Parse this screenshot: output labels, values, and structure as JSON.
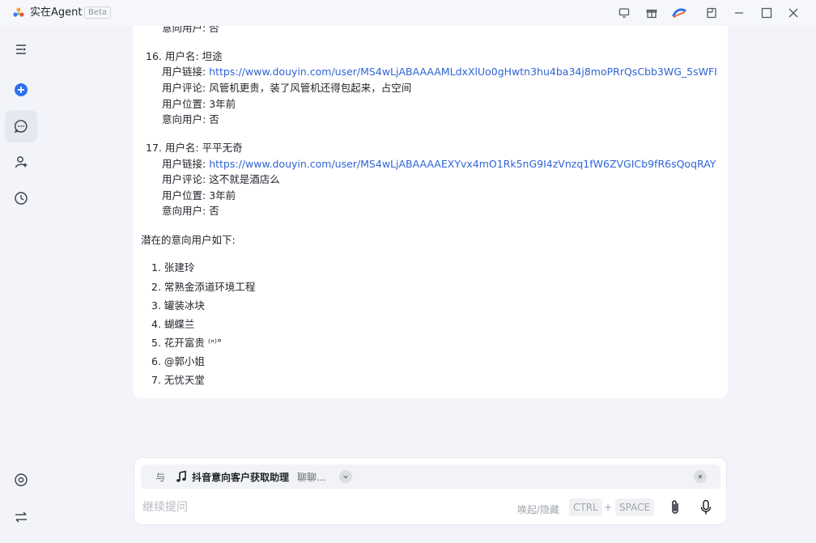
{
  "app": {
    "title": "实在Agent",
    "badge": "Beta"
  },
  "messages": {
    "partial_top": "意向用户: 否",
    "users": [
      {
        "index": "16.",
        "name_label": "用户名: ",
        "name": "坦途",
        "link_label": "用户链接: ",
        "link": "https://www.douyin.com/user/MS4wLjABAAAAMLdxXlUo0gHwtn3hu4ba34j8moPRrQsCbb3WG_5sWFI",
        "comment_label": "用户评论: ",
        "comment": "风管机更贵，装了风管机还得包起来，占空间",
        "location_label": "用户位置: ",
        "location": "3年前",
        "intent_label": "意向用户: ",
        "intent": "否"
      },
      {
        "index": "17.",
        "name_label": "用户名: ",
        "name": "平平无奇",
        "link_label": "用户链接: ",
        "link": "https://www.douyin.com/user/MS4wLjABAAAAEXYvx4mO1Rk5nG9I4zVnzq1fW6ZVGICb9fR6sQoqRAY",
        "comment_label": "用户评论: ",
        "comment": "这不就是酒店么",
        "location_label": "用户位置: ",
        "location": "3年前",
        "intent_label": "意向用户: ",
        "intent": "否"
      }
    ],
    "potential_heading": "潜在的意向用户如下:",
    "potential": [
      {
        "n": "1.",
        "name": "张建玲"
      },
      {
        "n": "2.",
        "name": "常熟金添道环境工程"
      },
      {
        "n": "3.",
        "name": "罐装冰块"
      },
      {
        "n": "4.",
        "name": "蝴蝶兰"
      },
      {
        "n": "5.",
        "name": "花开富贵 ⁽ᐢ⁾°"
      },
      {
        "n": "6.",
        "name": "@郭小姐"
      },
      {
        "n": "7.",
        "name": "无忧天堂"
      }
    ]
  },
  "input": {
    "with_label": "与",
    "agent_name": "抖音意向客户获取助理",
    "agent_sub": "聊聊...",
    "placeholder": "继续提问",
    "hint": "唤起/隐藏",
    "key1": "CTRL",
    "plus": "+",
    "key2": "SPACE"
  },
  "colors": {
    "link": "#2f64d6",
    "brand_blue": "#2b6ff2"
  },
  "icons": {
    "sidebar": [
      "menu-collapse-icon",
      "new-chat-icon",
      "chat-icon",
      "agent-user-icon",
      "history-icon",
      "settings-icon",
      "switch-icon"
    ],
    "titlebar": [
      "monitor-icon",
      "gift-icon",
      "brand-swirl-icon",
      "panel-icon",
      "minimize-icon",
      "maximize-icon",
      "close-icon"
    ]
  }
}
